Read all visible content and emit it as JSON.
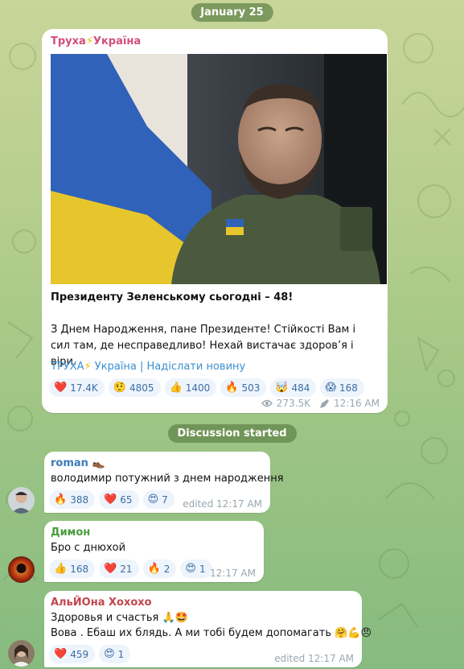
{
  "date_label": "January 25",
  "discussion_label": "Discussion started",
  "colors": {
    "accent": "#3a8fd0",
    "channel_name": "#d24e7a",
    "author_roman": "#3d7bb6",
    "author_dimon": "#4a9e3a",
    "author_alyona": "#c0474e"
  },
  "post": {
    "channel_name": "Труха",
    "channel_bolt": "⚡",
    "channel_suffix": "Україна",
    "photo_icon": "portrait-photo",
    "title": "Президенту Зеленському сьогодні – 48!",
    "text": "З Днем Народження, пане Президенте! Стійкості Вам і сил там, де несправедливо! Нехай вистачає здоров’я і віри.",
    "links": {
      "channel": "ТРУХА",
      "bolt": "⚡",
      "country": "Україна",
      "sep": " | ",
      "submit": "Надіслати новину"
    },
    "reactions": [
      {
        "emoji": "❤️",
        "icon": "red-heart-icon",
        "count": "17.4K"
      },
      {
        "emoji": "🤨",
        "icon": "raised-eyebrow-icon",
        "count": "4805"
      },
      {
        "emoji": "👍",
        "icon": "thumbs-up-icon",
        "count": "1400"
      },
      {
        "emoji": "🔥",
        "icon": "fire-icon",
        "count": "503"
      },
      {
        "emoji": "🤯",
        "icon": "exploding-head-icon",
        "count": "484"
      },
      {
        "emoji": "😱",
        "icon": "screaming-face-icon",
        "count": "168"
      }
    ],
    "views": "273.5K",
    "time": "12:16 AM"
  },
  "comments": [
    {
      "author": "roman",
      "author_badge": "👞",
      "text_lines": [
        "володимир потужний з днем народження"
      ],
      "reactions": [
        {
          "emoji": "🔥",
          "icon": "fire-icon",
          "count": "388"
        },
        {
          "emoji": "❤️",
          "icon": "red-heart-icon",
          "count": "65"
        },
        {
          "emoji": "😍",
          "icon": "heart-eyes-icon",
          "count": "7"
        }
      ],
      "meta": "edited 12:17 AM"
    },
    {
      "author": "Димон",
      "text_lines": [
        "Бро с днюхой"
      ],
      "reactions": [
        {
          "emoji": "👍",
          "icon": "thumbs-up-icon",
          "count": "168"
        },
        {
          "emoji": "❤️",
          "icon": "red-heart-icon",
          "count": "21"
        },
        {
          "emoji": "🔥",
          "icon": "fire-icon",
          "count": "2"
        },
        {
          "emoji": "😍",
          "icon": "heart-eyes-icon",
          "count": "1"
        }
      ],
      "meta": "12:17 AM"
    },
    {
      "author": "АльЙОна Хохохо",
      "text_lines": [
        "Здоровья и счастья 🙏🤩",
        "Вова . Ебаш их блядь. А ми тобі будем допомагать 🤗💪😠"
      ],
      "reactions": [
        {
          "emoji": "❤️",
          "icon": "red-heart-icon",
          "count": "459"
        },
        {
          "emoji": "😍",
          "icon": "heart-eyes-icon",
          "count": "1"
        }
      ],
      "meta": "edited 12:17 AM"
    }
  ]
}
